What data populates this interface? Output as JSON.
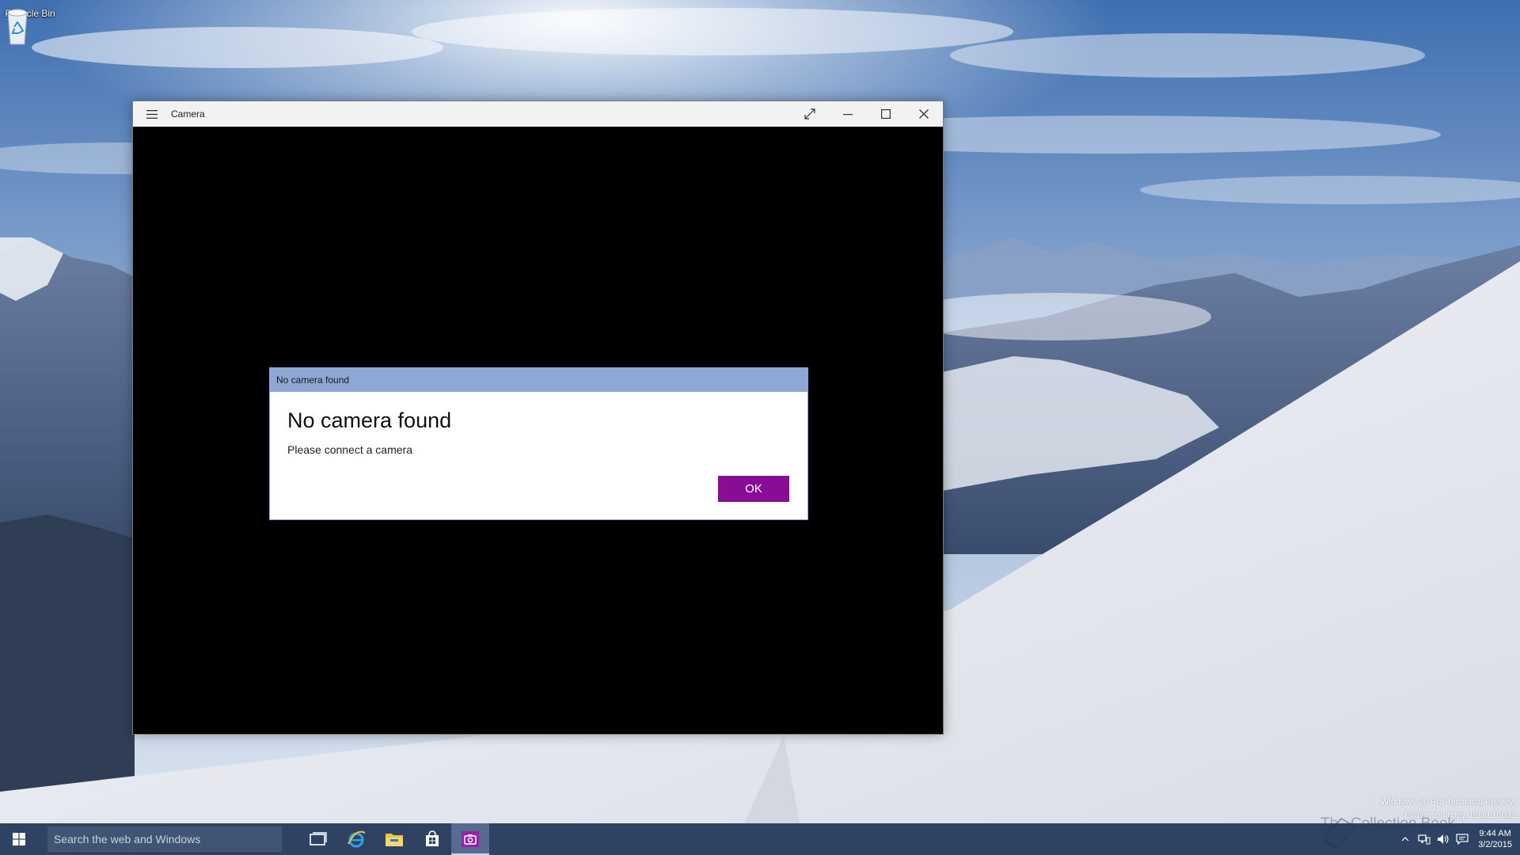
{
  "desktop": {
    "icons": [
      {
        "label": "Recycle Bin",
        "icon": "recycle-bin-icon"
      }
    ],
    "watermark": {
      "line1": "Windows 10 Pro Technical Preview",
      "line2": "Evaluation copy. Build 10031"
    },
    "brand_overlay": "The Collection Book"
  },
  "window": {
    "title": "Camera",
    "menu_icon": "hamburger-icon",
    "controls": [
      "fullscreen-icon",
      "minimize-icon",
      "maximize-icon",
      "close-icon"
    ]
  },
  "dialog": {
    "titlebar": "No camera found",
    "heading": "No camera found",
    "message": "Please connect a camera",
    "ok_label": "OK",
    "accent": "#870d94"
  },
  "taskbar": {
    "search_placeholder": "Search the web and Windows",
    "apps": [
      {
        "icon": "task-view-icon"
      },
      {
        "icon": "internet-explorer-icon"
      },
      {
        "icon": "file-explorer-icon"
      },
      {
        "icon": "store-icon"
      },
      {
        "icon": "camera-app-icon",
        "active": true
      }
    ],
    "clock": {
      "time": "9:44 AM",
      "date": "3/2/2015"
    }
  },
  "colors": {
    "taskbar": "#203458",
    "dialog_titlebar": "#8fa7d5",
    "window_titlebar": "#f2f2f2"
  }
}
